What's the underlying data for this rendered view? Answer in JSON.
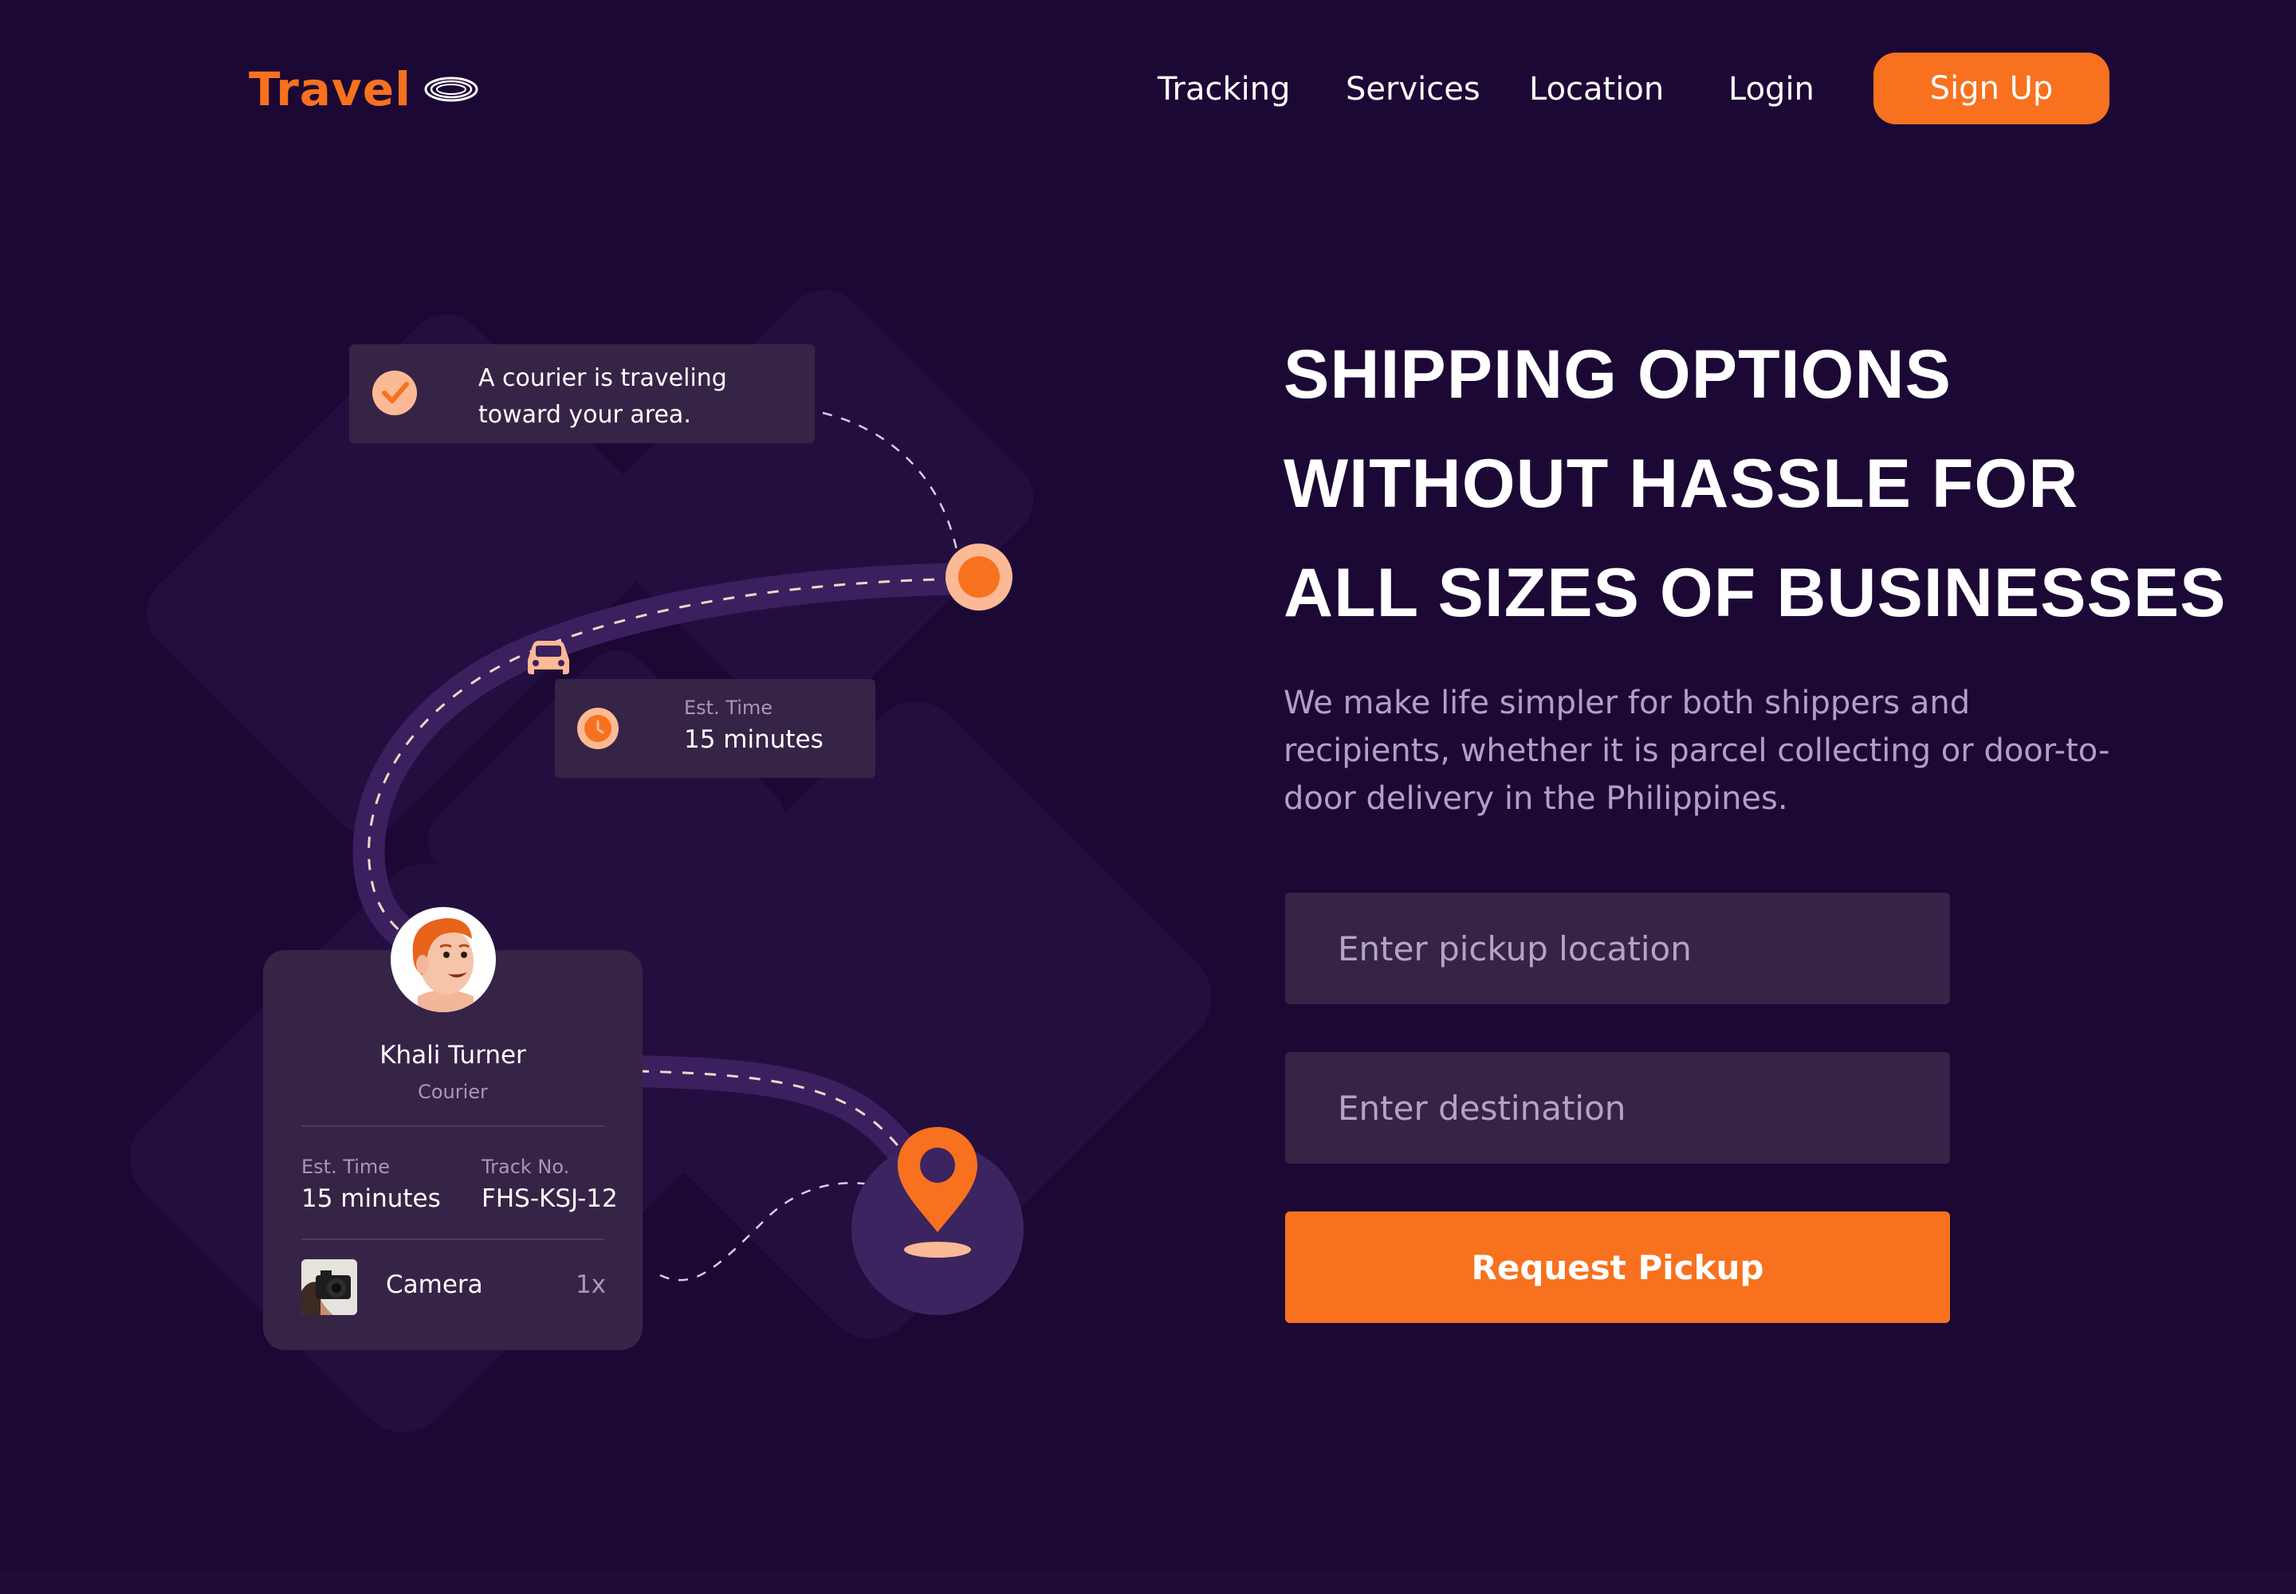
{
  "header": {
    "logo_text": "Travel",
    "logo_icon": "ring-icon",
    "nav": {
      "tracking": "Tracking",
      "services": "Services",
      "location": "Location",
      "login": "Login"
    },
    "signup_label": "Sign Up"
  },
  "hero": {
    "title_lines": [
      "SHIPPING OPTIONS",
      "WITHOUT HASSLE FOR",
      "ALL SIZES OF BUSINESSES"
    ],
    "subtitle": "We make life simpler for both shippers and recipients, whether it is parcel collecting or door-to-door delivery in the Philippines.",
    "pickup_placeholder": "Enter pickup location",
    "destination_placeholder": "Enter destination",
    "request_label": "Request Pickup"
  },
  "illustration": {
    "notification": {
      "text": "A courier is traveling toward your area.",
      "icon": "check-circle-icon"
    },
    "eta_card": {
      "label": "Est. Time",
      "value": "15 minutes",
      "icon": "clock-icon"
    },
    "vehicle_icon": "car-icon",
    "destination_icon": "map-pin-icon",
    "profile": {
      "name": "Khali Turner",
      "role": "Courier",
      "est_label": "Est. Time",
      "est_value": "15 minutes",
      "track_label": "Track No.",
      "track_value": "FHS-KSJ-12",
      "item_name": "Camera",
      "item_qty": "1x",
      "item_icon": "camera-thumbnail"
    }
  },
  "colors": {
    "background": "#1c0835",
    "accent": "#f7711f",
    "card": "#362446",
    "route": "#3b2060",
    "muted_text": "#b29ec7"
  }
}
